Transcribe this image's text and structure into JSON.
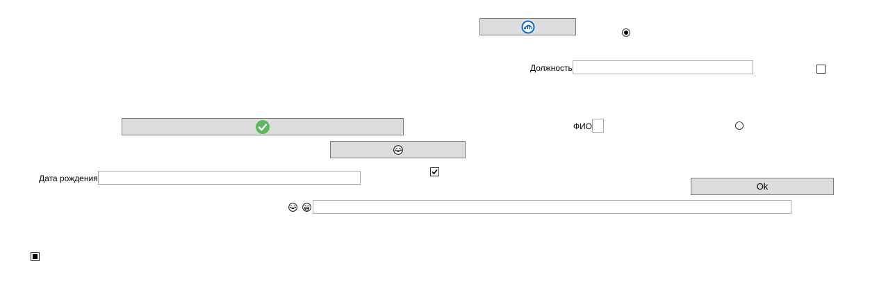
{
  "buttons": {
    "ok_label": "Ok",
    "top_icon": "cloud-icon",
    "wide_icon": "check-circle-icon",
    "mid_icon": "laughing-face-icon"
  },
  "labels": {
    "position": "Должность",
    "fio": "ФИО",
    "birth_date": "Дата рождения"
  },
  "fields": {
    "position_value": "",
    "fio_value": "",
    "birth_date_value": "",
    "emoji_field_value": ""
  },
  "controls": {
    "radio_top_checked": true,
    "radio_mid_checked": false,
    "checkbox_right_checked": false,
    "checkbox_mid_checked": true,
    "checkbox_bottom_state": "indeterminate"
  },
  "emoji_prefix_icons": [
    "laughing-face-icon",
    "grinning-face-icon"
  ],
  "colors": {
    "check_green": "#5cb85c",
    "cloud_blue": "#1565c0",
    "button_bg": "#dcdcdc"
  }
}
